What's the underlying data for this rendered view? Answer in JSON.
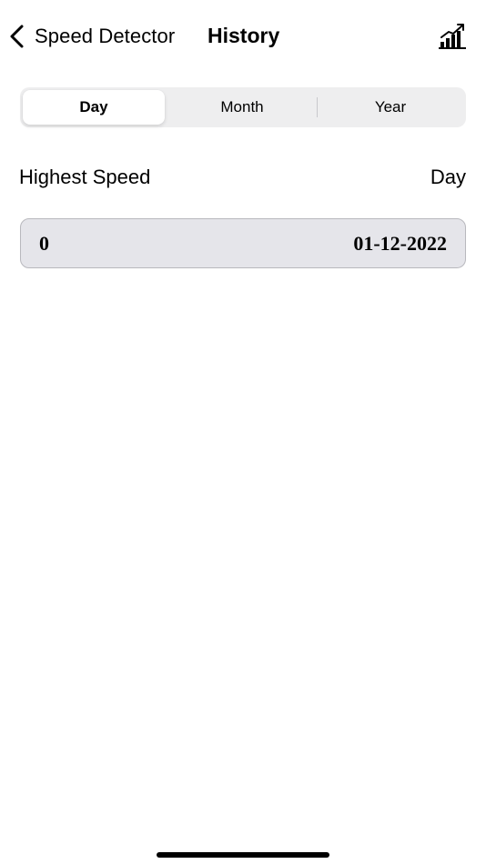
{
  "nav": {
    "back_label": "Speed Detector",
    "title": "History",
    "back_icon": "chevron-left-icon",
    "action_icon": "bar-chart-trend-icon"
  },
  "segments": [
    {
      "label": "Day",
      "selected": true
    },
    {
      "label": "Month",
      "selected": false
    },
    {
      "label": "Year",
      "selected": false
    }
  ],
  "list_header": {
    "left": "Highest Speed",
    "right": "Day"
  },
  "records": [
    {
      "speed": "0",
      "date": "01-12-2022"
    }
  ],
  "colors": {
    "segment_track": "#eeeeef",
    "segment_selected": "#ffffff",
    "row_background": "#e5e5ea",
    "row_border": "#b8b8bd",
    "text": "#000000"
  }
}
